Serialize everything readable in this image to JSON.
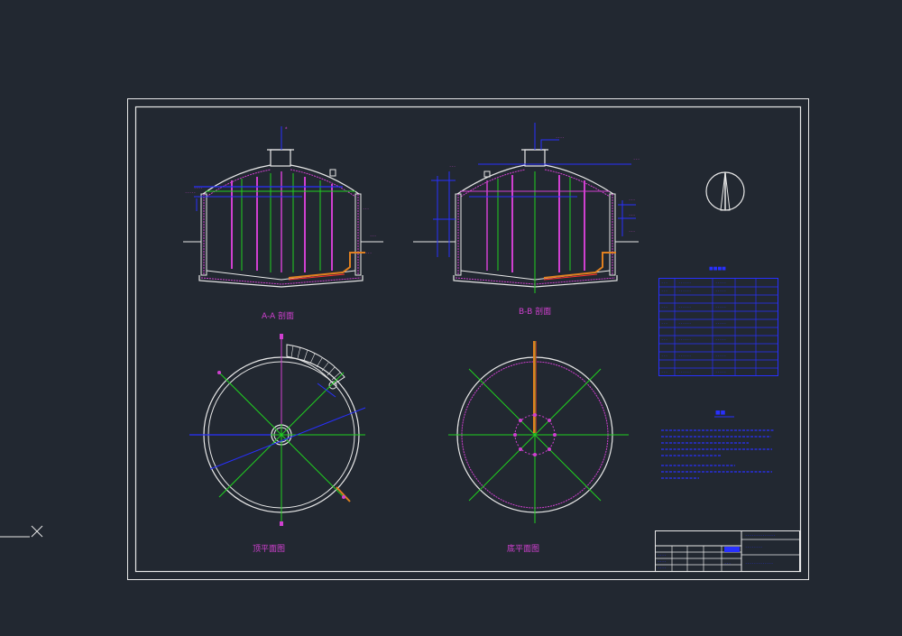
{
  "views": {
    "section_aa": "A-A 剖面",
    "section_bb": "B-B 剖面",
    "top_plan": "顶平面图",
    "bottom_plan": "底平面图"
  },
  "colors": {
    "background": "#222831",
    "line": "#e8e8e8",
    "magenta": "#d040d0",
    "green": "#20d020",
    "blue": "#2830ff",
    "orange": "#e08020",
    "red": "#ff3030"
  },
  "icons": [
    "north-arrow-icon",
    "ucs-crosshair-icon"
  ]
}
